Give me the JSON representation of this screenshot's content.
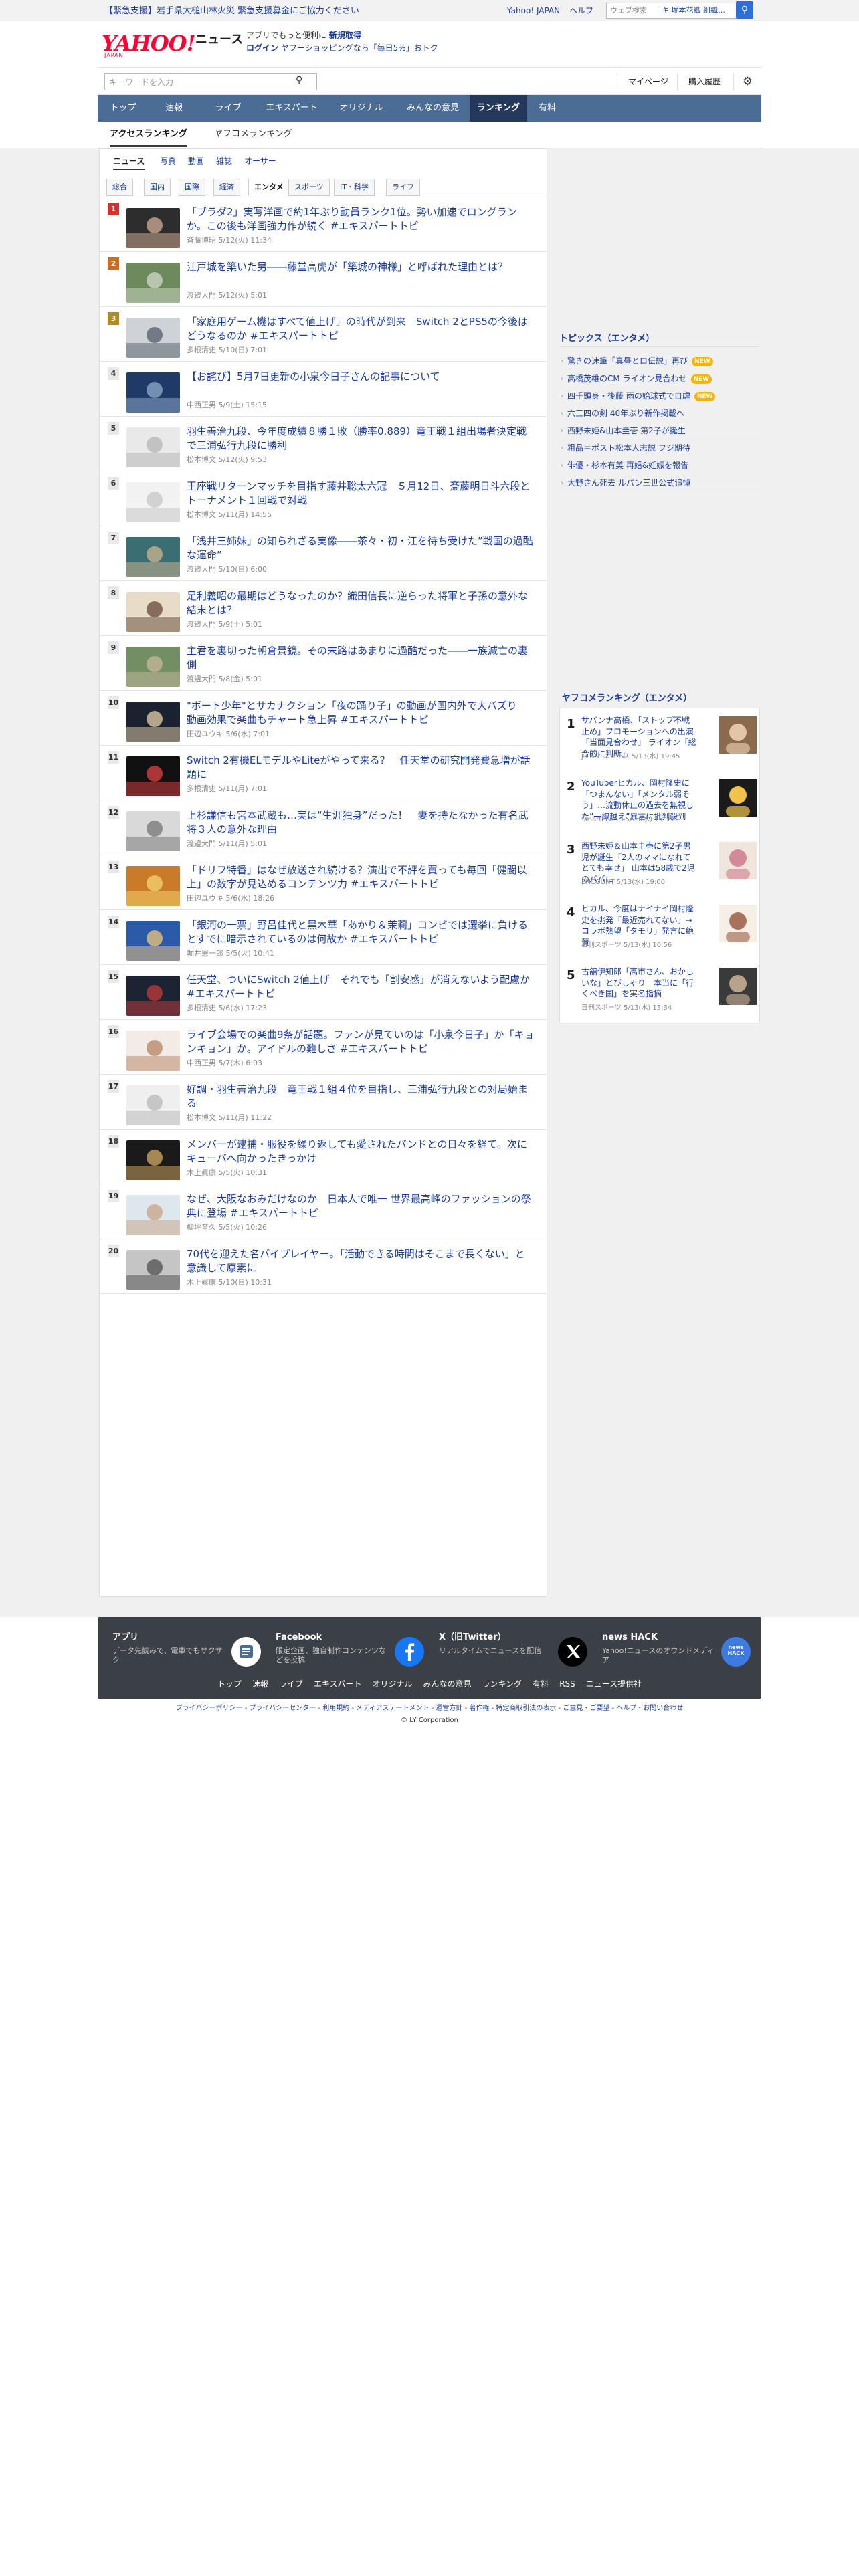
{
  "topbar": {
    "emergency": "【緊急支援】岩手県大槌山林火災 緊急支援募金にご協力ください",
    "yahoo_japan": "Yahoo! JAPAN",
    "help": "ヘルプ",
    "web_search_placeholder": "ウェブ検索",
    "web_search_keyword": "キ 堀本花織 組織…"
  },
  "header": {
    "logo": "YAHOO!",
    "logo_sub": "JAPAN",
    "service": "ニュース",
    "promo_line1_a": "アプリでもっと便利に",
    "promo_line1_b": "新規取得",
    "promo_line2_a": "ログイン",
    "promo_line2_b": "ヤフーショッピングなら「毎日5%」おトク"
  },
  "search": {
    "placeholder": "キーワードを入力",
    "mypage": "マイページ",
    "history": "購入履歴"
  },
  "gnav": [
    "トップ",
    "速報",
    "ライブ",
    "エキスパート",
    "オリジナル",
    "みんなの意見",
    "ランキング",
    "有料"
  ],
  "subtabs": [
    "アクセスランキング",
    "ヤフコメランキング"
  ],
  "categories1": [
    "ニュース",
    "写真",
    "動画",
    "雑誌",
    "オーサー"
  ],
  "categories2": [
    "総合",
    "国内",
    "国際",
    "経済",
    "エンタメ",
    "スポーツ",
    "IT・科学",
    "ライフ"
  ],
  "ranking": [
    {
      "rank": "1",
      "title": "「ブラダ2」実写洋画で約1年ぶり動員ランク1位。勢い加速でロングランか。この後も洋画強力作が続く #エキスパートトピ",
      "meta": "斉藤博昭  5/12(火) 11:34"
    },
    {
      "rank": "2",
      "title": "江戸城を築いた男――藤堂高虎が「築城の神様」と呼ばれた理由とは？",
      "meta": "渡邉大門  5/12(火) 5:01"
    },
    {
      "rank": "3",
      "title": "「家庭用ゲーム機はすべて値上げ」の時代が到来　Switch 2とPS5の今後はどうなるのか #エキスパートトピ",
      "meta": "多根清史  5/10(日) 7:01"
    },
    {
      "rank": "4",
      "title": "【お詫び】5月7日更新の小泉今日子さんの記事について",
      "meta": "中西正男  5/9(土) 15:15"
    },
    {
      "rank": "5",
      "title": "羽生善治九段、今年度成績８勝１敗（勝率0.889）竜王戦１組出場者決定戦で三浦弘行九段に勝利",
      "meta": "松本博文  5/12(火) 9:53"
    },
    {
      "rank": "6",
      "title": "王座戦リターンマッチを目指す藤井聡太六冠　５月12日、斎藤明日斗六段とトーナメント１回戦で対戦",
      "meta": "松本博文  5/11(月) 14:55"
    },
    {
      "rank": "7",
      "title": "「浅井三姉妹」の知られざる実像――茶々・初・江を待ち受けた”戦国の過酷な運命”",
      "meta": "渡邉大門  5/10(日) 6:00"
    },
    {
      "rank": "8",
      "title": "足利義昭の最期はどうなったのか？織田信長に逆らった将軍と子孫の意外な結末とは？",
      "meta": "渡邉大門  5/9(土) 5:01"
    },
    {
      "rank": "9",
      "title": "主君を裏切った朝倉景鏡。その末路はあまりに過酷だった――一族滅亡の裏側",
      "meta": "渡邉大門  5/8(金) 5:01"
    },
    {
      "rank": "10",
      "title": "\"ボート少年\"とサカナクション「夜の踊り子」の動画が国内外で大バズり　動画効果で楽曲もチャート急上昇 #エキスパートトピ",
      "meta": "田辺ユウキ  5/6(水) 7:01"
    },
    {
      "rank": "11",
      "title": "Switch 2有機ELモデルやLiteがやって来る？　任天堂の研究開発費急増が話題に",
      "meta": "多根清史  5/11(月) 7:01"
    },
    {
      "rank": "12",
      "title": "上杉謙信も宮本武蔵も…実は“生涯独身”だった！　妻を持たなかった有名武将３人の意外な理由",
      "meta": "渡邉大門  5/11(月) 5:01"
    },
    {
      "rank": "13",
      "title": "「ドリフ特番」はなぜ放送され続ける？演出で不評を買っても毎回「健闘以上」の数字が見込めるコンテンツ力 #エキスパートトピ",
      "meta": "田辺ユウキ  5/6(水) 18:26"
    },
    {
      "rank": "14",
      "title": "「銀河の一票」野呂佳代と黒木華「あかり＆茉莉」コンビでは選挙に負けるとすでに暗示されているのは何故か #エキスパートトピ",
      "meta": "堀井憲一郎  5/5(火) 10:41"
    },
    {
      "rank": "15",
      "title": "任天堂、ついにSwitch 2値上げ　それでも「割安感」が消えないよう配慮か #エキスパートトピ",
      "meta": "多根清史  5/6(水) 17:23"
    },
    {
      "rank": "16",
      "title": "ライブ会場での楽曲9条が話題。ファンが見ていのは「小泉今日子」か「キョンキョン」か。アイドルの難しさ #エキスパートトピ",
      "meta": "中西正男  5/7(木) 6:03"
    },
    {
      "rank": "17",
      "title": "好調・羽生善治九段　竜王戦１組４位を目指し、三浦弘行九段との対局始まる",
      "meta": "松本博文  5/11(月) 11:22"
    },
    {
      "rank": "18",
      "title": "メンバーが逮捕・服役を繰り返しても愛されたバンドとの日々を経て。次にキューバへ向かったきっかけ",
      "meta": "木上眞康  5/5(火) 10:31"
    },
    {
      "rank": "19",
      "title": "なぜ、大阪なおみだけなのか　日本人で唯一 世界最高峰のファッションの祭典に登場 #エキスパートトピ",
      "meta": "柳坪育久  5/5(火) 10:26"
    },
    {
      "rank": "20",
      "title": "70代を迎えた名パイプレイヤー。「活動できる時間はそこまで長くない」と意識して原素に",
      "meta": "木上眞康  5/10(日) 10:31"
    }
  ],
  "topics": {
    "heading": "トピックス（エンタメ）",
    "items": [
      {
        "text": "驚きの速筆「真昼とロ伝説」再び",
        "new": "NEW"
      },
      {
        "text": "高橋茂雄のCM ライオン見合わせ",
        "new": "NEW"
      },
      {
        "text": "四千頭身・後藤 雨の始球式で自虐",
        "new": "NEW"
      },
      {
        "text": "六三四の剣 40年ぶり新作掲載へ",
        "new": ""
      },
      {
        "text": "西野未姫&山本圭壱 第2子が誕生",
        "new": ""
      },
      {
        "text": "粗品＝ポスト松本人志説 フジ期待",
        "new": ""
      },
      {
        "text": "俳優・杉本有美 再婚&妊娠を報告",
        "new": ""
      },
      {
        "text": "大野さん死去 ルパン三世公式追悼",
        "new": ""
      }
    ]
  },
  "yafo": {
    "heading": "ヤフコメランキング（エンタメ）",
    "items": [
      {
        "rank": "1",
        "title": "サバンナ高橋、「ストップ不戦止め」プロモーションへの出演「当面見合わせ」 ライオン「総合的に判断」",
        "meta": "J-CASTニュース 5/13(水) 19:45"
      },
      {
        "rank": "2",
        "title": "YouTuberヒカル、岡村隆史に「つまんない」「メンタル弱そう」…流動休止の過去を無視した”一線越え”暴言に批判殺到",
        "meta": "SmartFLASH 5/13(水) 15:35"
      },
      {
        "rank": "3",
        "title": "西野未姫＆山本圭壱に第2子男児が誕生「2人のママになれてとても幸せ」 山本は58歳で2児のパパに",
        "meta": "ENCOUNT 5/13(水) 19:00"
      },
      {
        "rank": "4",
        "title": "ヒカル、今度はナイナイ岡村隆史を挑発「最近売れてない」→コラボ熱望「タモリ」発言に絶賛",
        "meta": "日刊スポーツ 5/13(水) 10:56"
      },
      {
        "rank": "5",
        "title": "古舘伊知郎「高市さん、おかしいな」とびしゃり　本当に「行くべき国」を実名指摘",
        "meta": "日刊スポーツ 5/13(水) 13:34"
      }
    ]
  },
  "footer": {
    "cards": [
      {
        "title": "アプリ",
        "desc": "データ先読みで、電車でもサクサク"
      },
      {
        "title": "Facebook",
        "desc": "限定企画、独自制作コンテンツなどを投稿"
      },
      {
        "title": "X（旧Twitter）",
        "desc": "リアルタイムでニュースを配信"
      },
      {
        "title": "news HACK",
        "desc": "Yahoo!ニュースのオウンドメディア"
      }
    ],
    "hack_badge": "news HACK",
    "nav": [
      "トップ",
      "速報",
      "ライブ",
      "エキスパート",
      "オリジナル",
      "みんなの意見",
      "ランキング",
      "有料",
      "RSS",
      "ニュース提供社"
    ],
    "legal": "プライバシーポリシー - プライバシーセンター - 利用規約 - メディアステートメント - 運営方針 - 著作権 - 特定商取引法の表示 - ご意見・ご要望 - ヘルプ・お問い合わせ",
    "copyright": "© LY Corporation"
  }
}
